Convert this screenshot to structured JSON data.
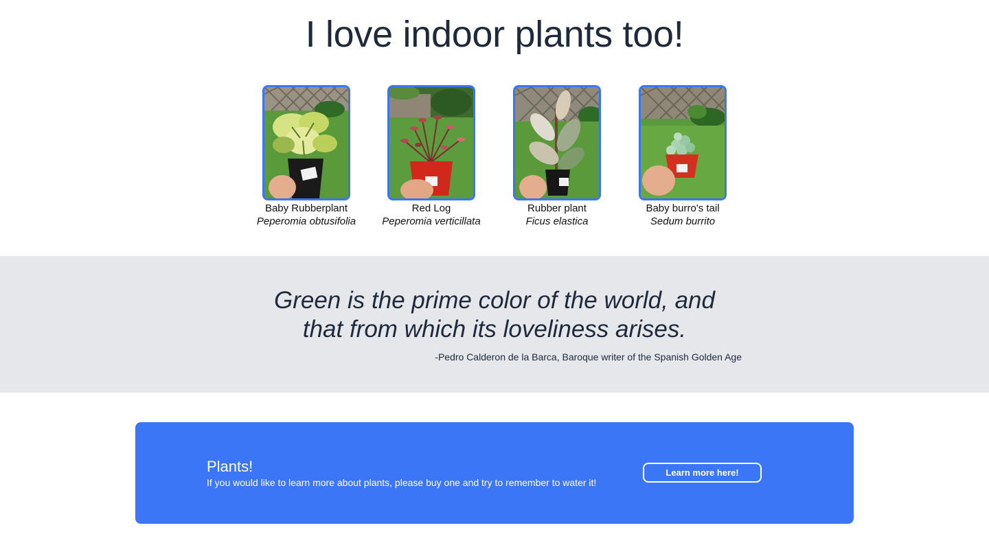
{
  "page": {
    "title": "I love indoor plants too!"
  },
  "plants": [
    {
      "name": "Baby Rubberplant",
      "scientific": "Peperomia obtusifolia",
      "photo_icon": "variegated-peperomia-photo"
    },
    {
      "name": "Red Log",
      "scientific": "Peperomia verticillata",
      "photo_icon": "red-log-plant-photo"
    },
    {
      "name": "Rubber plant",
      "scientific": "Ficus elastica",
      "photo_icon": "rubber-plant-photo"
    },
    {
      "name": "Baby burro's tail",
      "scientific": "Sedum burrito",
      "photo_icon": "burros-tail-photo"
    }
  ],
  "quote": {
    "line1": "Green is the prime color of the world, and",
    "line2": "that from which its loveliness arises.",
    "attribution": "-Pedro Calderon de la Barca, Baroque writer of the Spanish Golden Age"
  },
  "cta": {
    "title": "Plants!",
    "text": "If you would like to learn more about plants, please buy one and try to remember to water it!",
    "button_label": "Learn more here!"
  },
  "colors": {
    "accent": "#3b76f7",
    "quote_band": "#e5e7eb",
    "heading": "#1e293b"
  }
}
